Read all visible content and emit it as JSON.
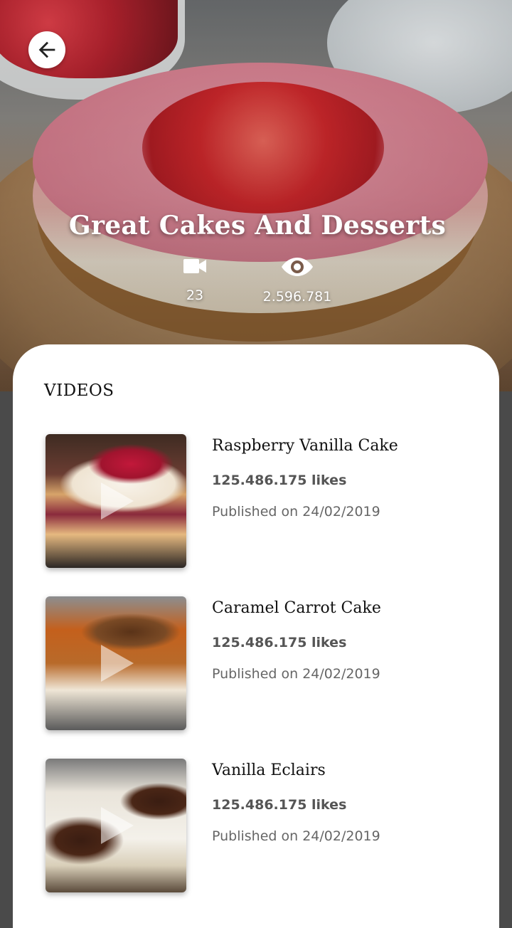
{
  "hero": {
    "title": "Great Cakes And Desserts",
    "video_count": "23",
    "view_count": "2.596.781",
    "back_icon": "arrow-left-icon",
    "videos_icon": "video-camera-icon",
    "views_icon": "eye-icon"
  },
  "videos_section": {
    "title": "VIDEOS",
    "items": [
      {
        "title": "Raspberry Vanilla Cake",
        "likes": "125.486.175 likes",
        "published": "Published on 24/02/2019"
      },
      {
        "title": "Caramel Carrot Cake",
        "likes": "125.486.175 likes",
        "published": "Published on 24/02/2019"
      },
      {
        "title": "Vanilla Eclairs",
        "likes": "125.486.175 likes",
        "published": "Published on 24/02/2019"
      }
    ]
  },
  "colors": {
    "card_background": "#ffffff",
    "page_background": "#4a4a4a",
    "title_text": "#111111",
    "meta_text": "#555555"
  }
}
